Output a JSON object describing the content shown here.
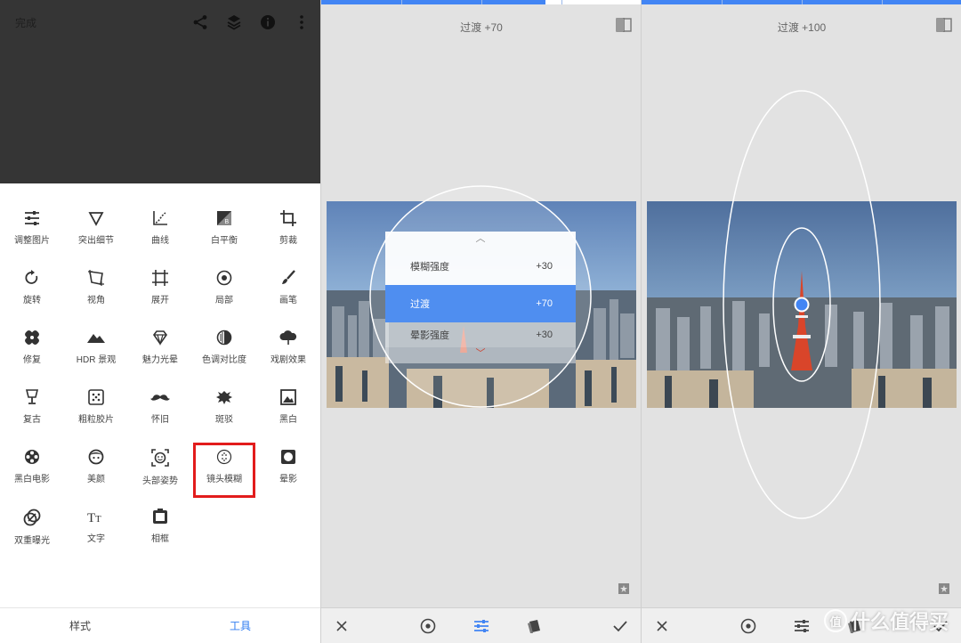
{
  "screen1": {
    "done_label": "完成",
    "tools": [
      {
        "label": "调整图片",
        "icon": "tune-sliders-icon"
      },
      {
        "label": "突出细节",
        "icon": "triangle-down-icon"
      },
      {
        "label": "曲线",
        "icon": "curves-icon"
      },
      {
        "label": "白平衡",
        "icon": "white-balance-icon"
      },
      {
        "label": "剪裁",
        "icon": "crop-icon"
      },
      {
        "label": "旋转",
        "icon": "rotate-icon"
      },
      {
        "label": "视角",
        "icon": "perspective-icon"
      },
      {
        "label": "展开",
        "icon": "expand-icon"
      },
      {
        "label": "局部",
        "icon": "selective-icon"
      },
      {
        "label": "画笔",
        "icon": "brush-icon"
      },
      {
        "label": "修复",
        "icon": "healing-icon"
      },
      {
        "label": "HDR 景观",
        "icon": "mountain-icon"
      },
      {
        "label": "魅力光晕",
        "icon": "glamour-glow-icon"
      },
      {
        "label": "色调对比度",
        "icon": "tonal-contrast-icon"
      },
      {
        "label": "戏剧效果",
        "icon": "drama-cloud-icon"
      },
      {
        "label": "复古",
        "icon": "vintage-lamp-icon"
      },
      {
        "label": "粗粒胶片",
        "icon": "grainy-film-icon"
      },
      {
        "label": "怀旧",
        "icon": "mustache-icon"
      },
      {
        "label": "斑驳",
        "icon": "grunge-icon"
      },
      {
        "label": "黑白",
        "icon": "black-white-icon"
      },
      {
        "label": "黑白电影",
        "icon": "film-reel-icon"
      },
      {
        "label": "美颜",
        "icon": "face-icon"
      },
      {
        "label": "头部姿势",
        "icon": "head-pose-icon"
      },
      {
        "label": "镜头模糊",
        "icon": "lens-blur-icon"
      },
      {
        "label": "晕影",
        "icon": "vignette-icon"
      },
      {
        "label": "双重曝光",
        "icon": "double-exposure-icon"
      },
      {
        "label": "文字",
        "icon": "text-icon"
      },
      {
        "label": "相框",
        "icon": "frame-icon"
      }
    ],
    "selected_tool": "镜头模糊",
    "tabs": [
      {
        "label": "样式",
        "active": false
      },
      {
        "label": "工具",
        "active": true
      }
    ]
  },
  "screen2": {
    "title": "过渡 +70",
    "progress": 0.7,
    "menu": {
      "up_glyph": "︿",
      "down_glyph": "﹀",
      "items": [
        {
          "label": "模糊强度",
          "value": "+30"
        },
        {
          "label": "过渡",
          "value": "+70"
        },
        {
          "label": "晕影强度",
          "value": "+30"
        }
      ]
    }
  },
  "screen3": {
    "title": "过渡 +100",
    "progress": 1.0
  },
  "watermark": {
    "circle_text": "值",
    "text": "什么值得买"
  },
  "colors": {
    "accent": "#4285f4",
    "highlight_row": "#4f8ef0",
    "selection_outline": "#e21c1c",
    "dark_top": "#353535"
  }
}
